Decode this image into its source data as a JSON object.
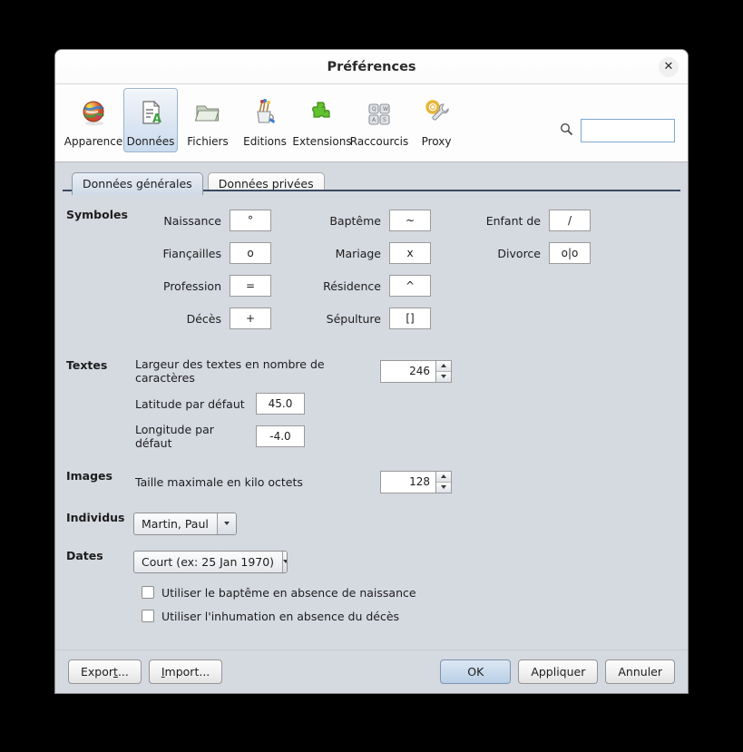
{
  "window": {
    "title": "Préférences",
    "close_label": "✕"
  },
  "toolbar": {
    "items": [
      {
        "label": "Apparence",
        "icon": "globe-flags-icon",
        "selected": false
      },
      {
        "label": "Données",
        "icon": "document-a-icon",
        "selected": true
      },
      {
        "label": "Fichiers",
        "icon": "folder-icon",
        "selected": false
      },
      {
        "label": "Editions",
        "icon": "brush-cup-icon",
        "selected": false
      },
      {
        "label": "Extensions",
        "icon": "puzzle-piece-icon",
        "selected": false
      },
      {
        "label": "Raccourcis",
        "icon": "keyboard-keys-icon",
        "selected": false
      },
      {
        "label": "Proxy",
        "icon": "gear-wrench-icon",
        "selected": false
      }
    ],
    "search": {
      "value": "",
      "placeholder": "",
      "icon": "search-icon"
    }
  },
  "tabs": [
    {
      "label": "Données générales",
      "active": true
    },
    {
      "label": "Données privées",
      "active": false
    }
  ],
  "sections": {
    "symboles": {
      "title": "Symboles",
      "fields": [
        {
          "label": "Naissance",
          "value": "°"
        },
        {
          "label": "Baptême",
          "value": "~"
        },
        {
          "label": "Enfant de",
          "value": "/"
        },
        {
          "label": "Fiançailles",
          "value": "o"
        },
        {
          "label": "Mariage",
          "value": "x"
        },
        {
          "label": "Divorce",
          "value": "o|o"
        },
        {
          "label": "Profession",
          "value": "="
        },
        {
          "label": "Résidence",
          "value": "^"
        },
        {
          "label": "Décès",
          "value": "+"
        },
        {
          "label": "Sépulture",
          "value": "[]"
        }
      ]
    },
    "textes": {
      "title": "Textes",
      "largeur_label": "Largeur des textes en nombre de caractères",
      "largeur_value": "246",
      "latitude_label": "Latitude par défaut",
      "latitude_value": "45.0",
      "longitude_label": "Longitude par défaut",
      "longitude_value": "-4.0"
    },
    "images": {
      "title": "Images",
      "taille_label": "Taille maximale en kilo octets",
      "taille_value": "128"
    },
    "individus": {
      "title": "Individus",
      "selected": "Martin, Paul"
    },
    "dates": {
      "title": "Dates",
      "selected": "Court (ex: 25 Jan 1970)",
      "checkbox_bapteme": "Utiliser le baptême en absence de naissance",
      "checkbox_inhumation": "Utiliser l'inhumation en absence du décès",
      "bapteme_checked": false,
      "inhumation_checked": false
    }
  },
  "footer": {
    "export_label": "Export...",
    "import_label": "Import...",
    "ok_label": "OK",
    "apply_label": "Appliquer",
    "cancel_label": "Annuler"
  },
  "colors": {
    "window_bg": "#d5d9e0",
    "accent": "#b9cfe6",
    "tab_active": "#cfdae8",
    "focus_border": "#7ea6d3"
  }
}
